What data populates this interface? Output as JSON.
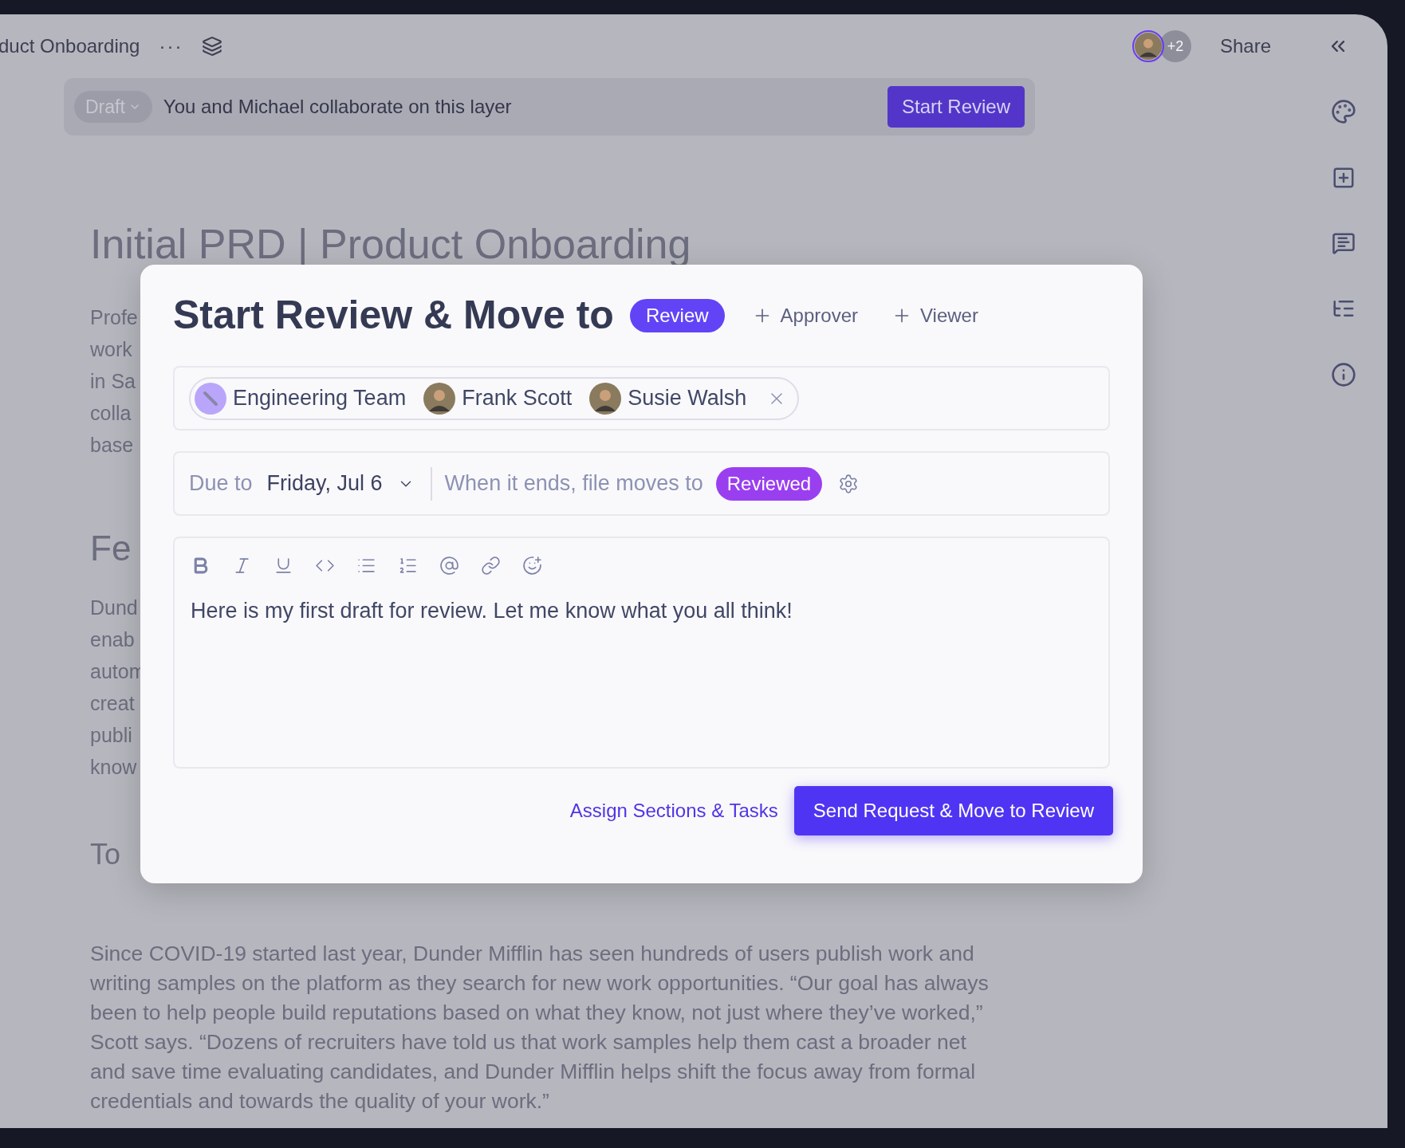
{
  "top_bar": {
    "doc_title": "duct Onboarding",
    "more": "···",
    "collaborators_extra": "+2",
    "share": "Share"
  },
  "banner": {
    "status": "Draft",
    "message": "You and Michael collaborate on this layer",
    "button": "Start Review"
  },
  "document": {
    "title": "Initial PRD | Product Onboarding",
    "intro_fragments": [
      "Profe",
      "work",
      "in Sa",
      "colla",
      "base"
    ],
    "heading_fragment": "Fe",
    "section_fragments": [
      "Dund",
      "enab",
      "autom",
      "creat",
      "publi",
      "know"
    ],
    "heading2_fragment": "To",
    "closing_paragraph": "Since COVID-19 started last year, Dunder Mifflin has seen hundreds of users publish work and writing samples on the platform as they search for new work opportunities. “Our goal has always been to help people build reputations based on what they know, not just where they’ve worked,” Scott says. “Dozens of recruiters have told us that work samples help them cast a broader net and save time evaluating candidates, and Dunder Mifflin helps shift the focus away from formal credentials and towards the quality of your work.”"
  },
  "modal": {
    "title": "Start Review & Move to",
    "stage": "Review",
    "add_buttons": [
      "Approver",
      "Viewer"
    ],
    "recipients": [
      {
        "name": "Engineering Team",
        "kind": "team"
      },
      {
        "name": "Frank Scott",
        "kind": "person"
      },
      {
        "name": "Susie Walsh",
        "kind": "person"
      }
    ],
    "due_label": "Due to",
    "due_date": "Friday, Jul 6",
    "moves_label": "When it ends, file moves to",
    "moves_stage": "Reviewed",
    "message": "Here is my first draft for review. Let me know what you all think!",
    "secondary_action": "Assign Sections & Tasks",
    "primary_action": "Send Request & Move to Review"
  }
}
